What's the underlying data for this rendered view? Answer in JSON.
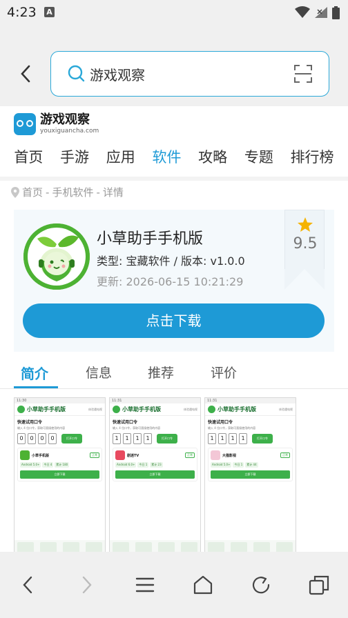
{
  "status": {
    "time": "4:23",
    "notif_letter": "A"
  },
  "browser": {
    "url_text": "游戏观察"
  },
  "site": {
    "logo_title": "游戏观察",
    "logo_domain": "youxiguancha.com"
  },
  "nav": [
    "首页",
    "手游",
    "应用",
    "软件",
    "攻略",
    "专题",
    "排行榜"
  ],
  "breadcrumb": {
    "home": "首页",
    "sep1": "-",
    "cat": "手机软件",
    "sep2": "-",
    "current": "详情"
  },
  "app": {
    "name": "小草助手手机版",
    "type": "类型: 宝藏软件 / 版本: v1.0.0",
    "updated": "更新:  2026-06-15 10:21:29",
    "rating": "9.5",
    "download_label": "点击下载"
  },
  "tabs": [
    "简介",
    "信息",
    "推荐",
    "评价"
  ],
  "screenshots": [
    {
      "status": "11:30",
      "title": "小草助手手机版",
      "hint": "体验遇电视",
      "sub": "快速试用口令",
      "desc": "输入 4 位口令，获取可直接使用的内容",
      "code": [
        "0",
        "0",
        "0",
        "0"
      ],
      "go": "打开口令",
      "item_name": "小草手机版",
      "item_badge": "正常",
      "tags": [
        "Android 5.0+",
        "今日 4",
        "累计 180"
      ],
      "download": "立即下载"
    },
    {
      "status": "11:31",
      "title": "小草助手手机版",
      "hint": "体验遇电视",
      "sub": "快速试用口令",
      "desc": "输入 4 位口令，获取可直接使用的内容",
      "code": [
        "1",
        "1",
        "1",
        "1"
      ],
      "go": "打开口令",
      "item_name": "剧迷TV",
      "item_badge": "正常",
      "tags": [
        "Android 6.0+",
        "今日 1",
        "累计 23"
      ],
      "download": "立即下载"
    },
    {
      "status": "11:31",
      "title": "小草助手手机版",
      "hint": "体验遇电视",
      "sub": "快速试用口令",
      "desc": "输入 4 位口令，获取可直接使用的内容",
      "code": [
        "1",
        "1",
        "1",
        "1"
      ],
      "go": "打开口令",
      "item_name": "大猫影视",
      "item_badge": "正常",
      "tags": [
        "Android 5.0+",
        "今日 1",
        "累计 44"
      ],
      "download": "立即下载"
    }
  ],
  "colors": {
    "accent": "#1e9ad6",
    "app_green": "#4db233",
    "thumb_green": "#3db04a"
  }
}
